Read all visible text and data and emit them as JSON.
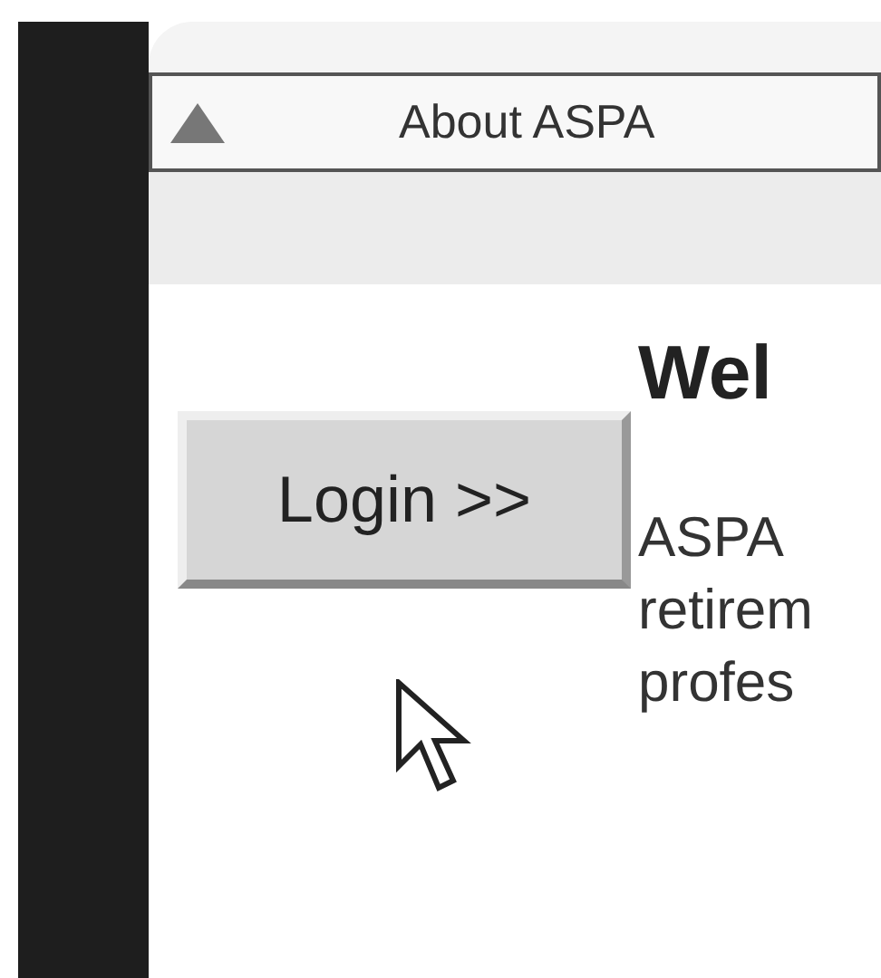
{
  "tab_bar": {
    "title": "About ASPA"
  },
  "login_button": {
    "label": "Login >>"
  },
  "heading": "Wel",
  "paragraph_lines": [
    "ASPA",
    "retirem",
    "profes"
  ]
}
